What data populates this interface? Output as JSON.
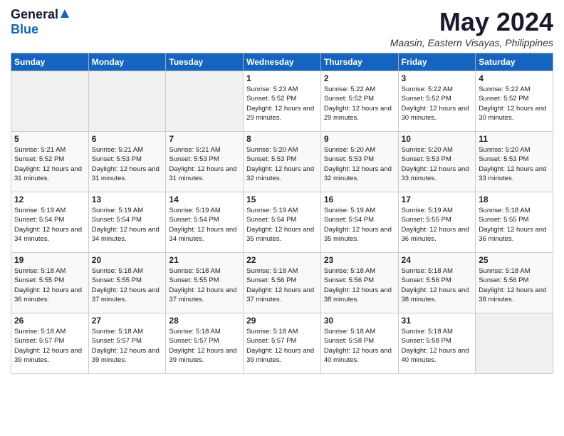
{
  "logo": {
    "general": "General",
    "blue": "Blue"
  },
  "title": {
    "month_year": "May 2024",
    "location": "Maasin, Eastern Visayas, Philippines"
  },
  "calendar": {
    "days_header": [
      "Sunday",
      "Monday",
      "Tuesday",
      "Wednesday",
      "Thursday",
      "Friday",
      "Saturday"
    ],
    "weeks": [
      [
        {
          "day": "",
          "sunrise": "",
          "sunset": "",
          "daylight": ""
        },
        {
          "day": "",
          "sunrise": "",
          "sunset": "",
          "daylight": ""
        },
        {
          "day": "",
          "sunrise": "",
          "sunset": "",
          "daylight": ""
        },
        {
          "day": "1",
          "sunrise": "Sunrise: 5:23 AM",
          "sunset": "Sunset: 5:52 PM",
          "daylight": "Daylight: 12 hours and 29 minutes."
        },
        {
          "day": "2",
          "sunrise": "Sunrise: 5:22 AM",
          "sunset": "Sunset: 5:52 PM",
          "daylight": "Daylight: 12 hours and 29 minutes."
        },
        {
          "day": "3",
          "sunrise": "Sunrise: 5:22 AM",
          "sunset": "Sunset: 5:52 PM",
          "daylight": "Daylight: 12 hours and 30 minutes."
        },
        {
          "day": "4",
          "sunrise": "Sunrise: 5:22 AM",
          "sunset": "Sunset: 5:52 PM",
          "daylight": "Daylight: 12 hours and 30 minutes."
        }
      ],
      [
        {
          "day": "5",
          "sunrise": "Sunrise: 5:21 AM",
          "sunset": "Sunset: 5:52 PM",
          "daylight": "Daylight: 12 hours and 31 minutes."
        },
        {
          "day": "6",
          "sunrise": "Sunrise: 5:21 AM",
          "sunset": "Sunset: 5:53 PM",
          "daylight": "Daylight: 12 hours and 31 minutes."
        },
        {
          "day": "7",
          "sunrise": "Sunrise: 5:21 AM",
          "sunset": "Sunset: 5:53 PM",
          "daylight": "Daylight: 12 hours and 31 minutes."
        },
        {
          "day": "8",
          "sunrise": "Sunrise: 5:20 AM",
          "sunset": "Sunset: 5:53 PM",
          "daylight": "Daylight: 12 hours and 32 minutes."
        },
        {
          "day": "9",
          "sunrise": "Sunrise: 5:20 AM",
          "sunset": "Sunset: 5:53 PM",
          "daylight": "Daylight: 12 hours and 32 minutes."
        },
        {
          "day": "10",
          "sunrise": "Sunrise: 5:20 AM",
          "sunset": "Sunset: 5:53 PM",
          "daylight": "Daylight: 12 hours and 33 minutes."
        },
        {
          "day": "11",
          "sunrise": "Sunrise: 5:20 AM",
          "sunset": "Sunset: 5:53 PM",
          "daylight": "Daylight: 12 hours and 33 minutes."
        }
      ],
      [
        {
          "day": "12",
          "sunrise": "Sunrise: 5:19 AM",
          "sunset": "Sunset: 5:54 PM",
          "daylight": "Daylight: 12 hours and 34 minutes."
        },
        {
          "day": "13",
          "sunrise": "Sunrise: 5:19 AM",
          "sunset": "Sunset: 5:54 PM",
          "daylight": "Daylight: 12 hours and 34 minutes."
        },
        {
          "day": "14",
          "sunrise": "Sunrise: 5:19 AM",
          "sunset": "Sunset: 5:54 PM",
          "daylight": "Daylight: 12 hours and 34 minutes."
        },
        {
          "day": "15",
          "sunrise": "Sunrise: 5:19 AM",
          "sunset": "Sunset: 5:54 PM",
          "daylight": "Daylight: 12 hours and 35 minutes."
        },
        {
          "day": "16",
          "sunrise": "Sunrise: 5:19 AM",
          "sunset": "Sunset: 5:54 PM",
          "daylight": "Daylight: 12 hours and 35 minutes."
        },
        {
          "day": "17",
          "sunrise": "Sunrise: 5:19 AM",
          "sunset": "Sunset: 5:55 PM",
          "daylight": "Daylight: 12 hours and 36 minutes."
        },
        {
          "day": "18",
          "sunrise": "Sunrise: 5:18 AM",
          "sunset": "Sunset: 5:55 PM",
          "daylight": "Daylight: 12 hours and 36 minutes."
        }
      ],
      [
        {
          "day": "19",
          "sunrise": "Sunrise: 5:18 AM",
          "sunset": "Sunset: 5:55 PM",
          "daylight": "Daylight: 12 hours and 36 minutes."
        },
        {
          "day": "20",
          "sunrise": "Sunrise: 5:18 AM",
          "sunset": "Sunset: 5:55 PM",
          "daylight": "Daylight: 12 hours and 37 minutes."
        },
        {
          "day": "21",
          "sunrise": "Sunrise: 5:18 AM",
          "sunset": "Sunset: 5:55 PM",
          "daylight": "Daylight: 12 hours and 37 minutes."
        },
        {
          "day": "22",
          "sunrise": "Sunrise: 5:18 AM",
          "sunset": "Sunset: 5:56 PM",
          "daylight": "Daylight: 12 hours and 37 minutes."
        },
        {
          "day": "23",
          "sunrise": "Sunrise: 5:18 AM",
          "sunset": "Sunset: 5:56 PM",
          "daylight": "Daylight: 12 hours and 38 minutes."
        },
        {
          "day": "24",
          "sunrise": "Sunrise: 5:18 AM",
          "sunset": "Sunset: 5:56 PM",
          "daylight": "Daylight: 12 hours and 38 minutes."
        },
        {
          "day": "25",
          "sunrise": "Sunrise: 5:18 AM",
          "sunset": "Sunset: 5:56 PM",
          "daylight": "Daylight: 12 hours and 38 minutes."
        }
      ],
      [
        {
          "day": "26",
          "sunrise": "Sunrise: 5:18 AM",
          "sunset": "Sunset: 5:57 PM",
          "daylight": "Daylight: 12 hours and 39 minutes."
        },
        {
          "day": "27",
          "sunrise": "Sunrise: 5:18 AM",
          "sunset": "Sunset: 5:57 PM",
          "daylight": "Daylight: 12 hours and 39 minutes."
        },
        {
          "day": "28",
          "sunrise": "Sunrise: 5:18 AM",
          "sunset": "Sunset: 5:57 PM",
          "daylight": "Daylight: 12 hours and 39 minutes."
        },
        {
          "day": "29",
          "sunrise": "Sunrise: 5:18 AM",
          "sunset": "Sunset: 5:57 PM",
          "daylight": "Daylight: 12 hours and 39 minutes."
        },
        {
          "day": "30",
          "sunrise": "Sunrise: 5:18 AM",
          "sunset": "Sunset: 5:58 PM",
          "daylight": "Daylight: 12 hours and 40 minutes."
        },
        {
          "day": "31",
          "sunrise": "Sunrise: 5:18 AM",
          "sunset": "Sunset: 5:58 PM",
          "daylight": "Daylight: 12 hours and 40 minutes."
        },
        {
          "day": "",
          "sunrise": "",
          "sunset": "",
          "daylight": ""
        }
      ]
    ]
  }
}
